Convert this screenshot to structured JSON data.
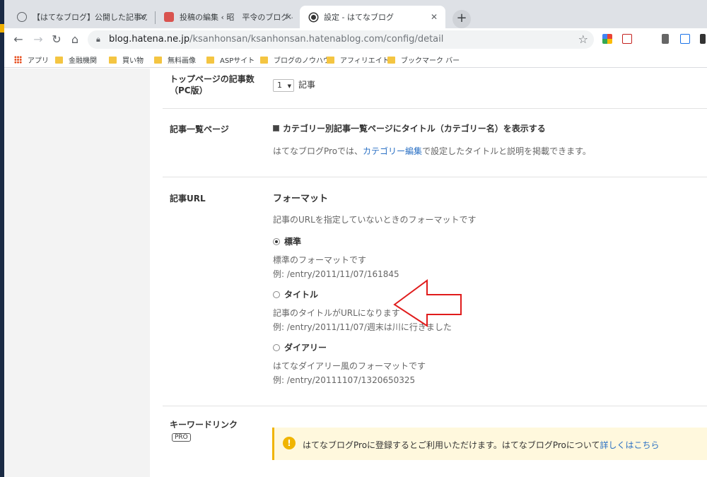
{
  "browser": {
    "tabs": [
      {
        "title": "【はてなブログ】公開した記事のURLを",
        "close": "✕"
      },
      {
        "title": "投稿の編集 ‹ 昭　平令のブログ — W",
        "close": "✕"
      },
      {
        "title": "設定 - はてなブログ",
        "close": "✕"
      }
    ],
    "new_tab": "+",
    "url_host": "blog.hatena.ne.jp",
    "url_path": "/ksanhonsan/ksanhonsan.hatenablog.com/config/detail"
  },
  "bookmarks": [
    {
      "label": "アプリ",
      "icon": "apps-icon"
    },
    {
      "label": "金融機関",
      "icon": "folder-icon"
    },
    {
      "label": "買い物",
      "icon": "folder-icon"
    },
    {
      "label": "無料画像",
      "icon": "folder-icon"
    },
    {
      "label": "ASPサイト",
      "icon": "folder-icon"
    },
    {
      "label": "ブログのノウハウ",
      "icon": "folder-icon"
    },
    {
      "label": "アフィリエイト",
      "icon": "folder-icon"
    },
    {
      "label": "ブックマーク バー",
      "icon": "folder-icon"
    }
  ],
  "settings": {
    "top_count": {
      "label_1": "トップページの記事数",
      "label_2": "（PC版）",
      "selected": "1",
      "unit": "記事"
    },
    "category_page": {
      "label": "記事一覧ページ",
      "checkbox_label": "カテゴリー別記事一覧ページにタイトル（カテゴリー名）を表示する",
      "note_pre": "はてなブログProでは、",
      "note_link": "カテゴリー編集",
      "note_post": "で設定したタイトルと説明を掲載できます。"
    },
    "article_url": {
      "label": "記事URL",
      "heading": "フォーマット",
      "description": "記事のURLを指定していないときのフォーマットです",
      "options": [
        {
          "label": "標準",
          "desc": "標準のフォーマットです",
          "example": "例: /entry/2011/11/07/161845",
          "selected": true
        },
        {
          "label": "タイトル",
          "desc": "記事のタイトルがURLになります",
          "example": "例: /entry/2011/11/07/週末は川に行きました",
          "selected": false
        },
        {
          "label": "ダイアリー",
          "desc": "はてなダイアリー風のフォーマットです",
          "example": "例: /entry/20111107/1320650325",
          "selected": false
        }
      ]
    },
    "keyword_link": {
      "label": "キーワードリンク",
      "badge": "PRO",
      "notice_icon": "!",
      "notice_text": "はてなブログProに登録するとご利用いただけます。はてなブログProについて",
      "notice_link": "詳しくはこちら"
    }
  },
  "colors": {
    "link": "#2a70c4",
    "notice_bg": "#fff8dd",
    "notice_accent": "#f0b400",
    "arrow": "#e01c1c"
  }
}
